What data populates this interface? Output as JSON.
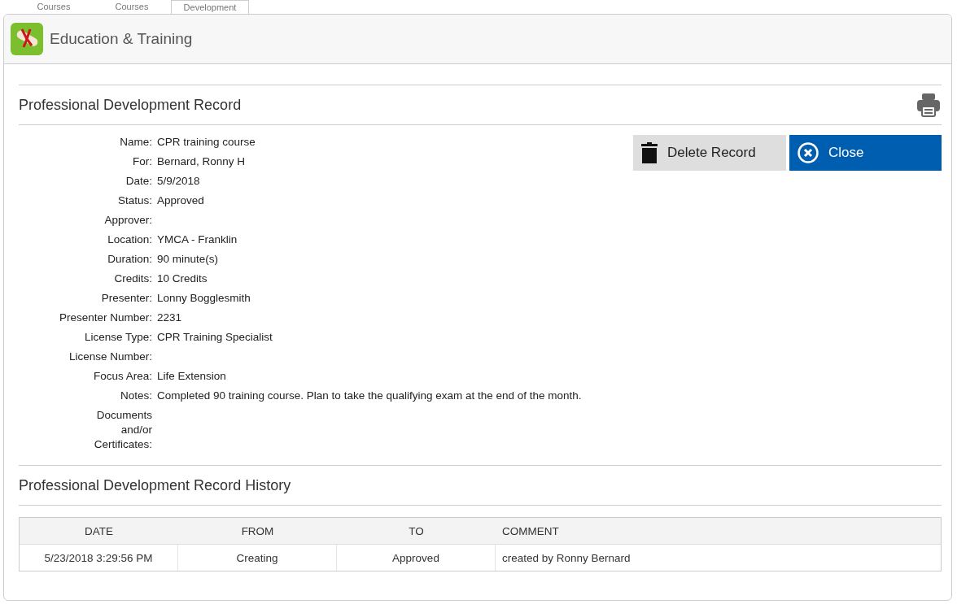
{
  "tabs": [
    {
      "label": "Courses",
      "selected": false
    },
    {
      "label": "Courses",
      "selected": false
    },
    {
      "label": "Development",
      "selected": true
    }
  ],
  "header": {
    "title": "Education & Training"
  },
  "record": {
    "title": "Professional Development Record",
    "buttons": [
      {
        "kind": "delete",
        "label": "Delete Record"
      },
      {
        "kind": "close",
        "label": "Close"
      }
    ],
    "fields": [
      {
        "label": "Name:",
        "value": "CPR training course"
      },
      {
        "label": "For:",
        "value": "Bernard, Ronny H"
      },
      {
        "label": "Date:",
        "value": "5/9/2018"
      },
      {
        "label": "Status:",
        "value": "Approved"
      },
      {
        "label": "Approver:"
      },
      {
        "label": "Location:",
        "value": "YMCA - Franklin"
      },
      {
        "label": "Duration:",
        "value": "90 minute(s)"
      },
      {
        "label": "Credits:",
        "value": "10 Credits"
      },
      {
        "label": "Presenter:",
        "value": "Lonny Bogglesmith"
      },
      {
        "label": "Presenter Number:",
        "value": "2231"
      },
      {
        "label": "License Type:",
        "value": "CPR Training Specialist"
      },
      {
        "label": "License Number:"
      },
      {
        "label": "Focus Area:",
        "value": "Life Extension"
      },
      {
        "label": "Notes:",
        "value": "Completed 90 training course. Plan to take the qualifying exam at the end of the month."
      },
      {
        "label": "Documents and/or Certificates:",
        "wrap": true
      }
    ]
  },
  "history": {
    "title": "Professional Development Record History",
    "columns": [
      "DATE",
      "FROM",
      "TO",
      "COMMENT"
    ],
    "rows": [
      [
        "5/23/2018 3:29:56 PM",
        "Creating",
        "Approved",
        "created by Ronny Bernard"
      ]
    ]
  }
}
